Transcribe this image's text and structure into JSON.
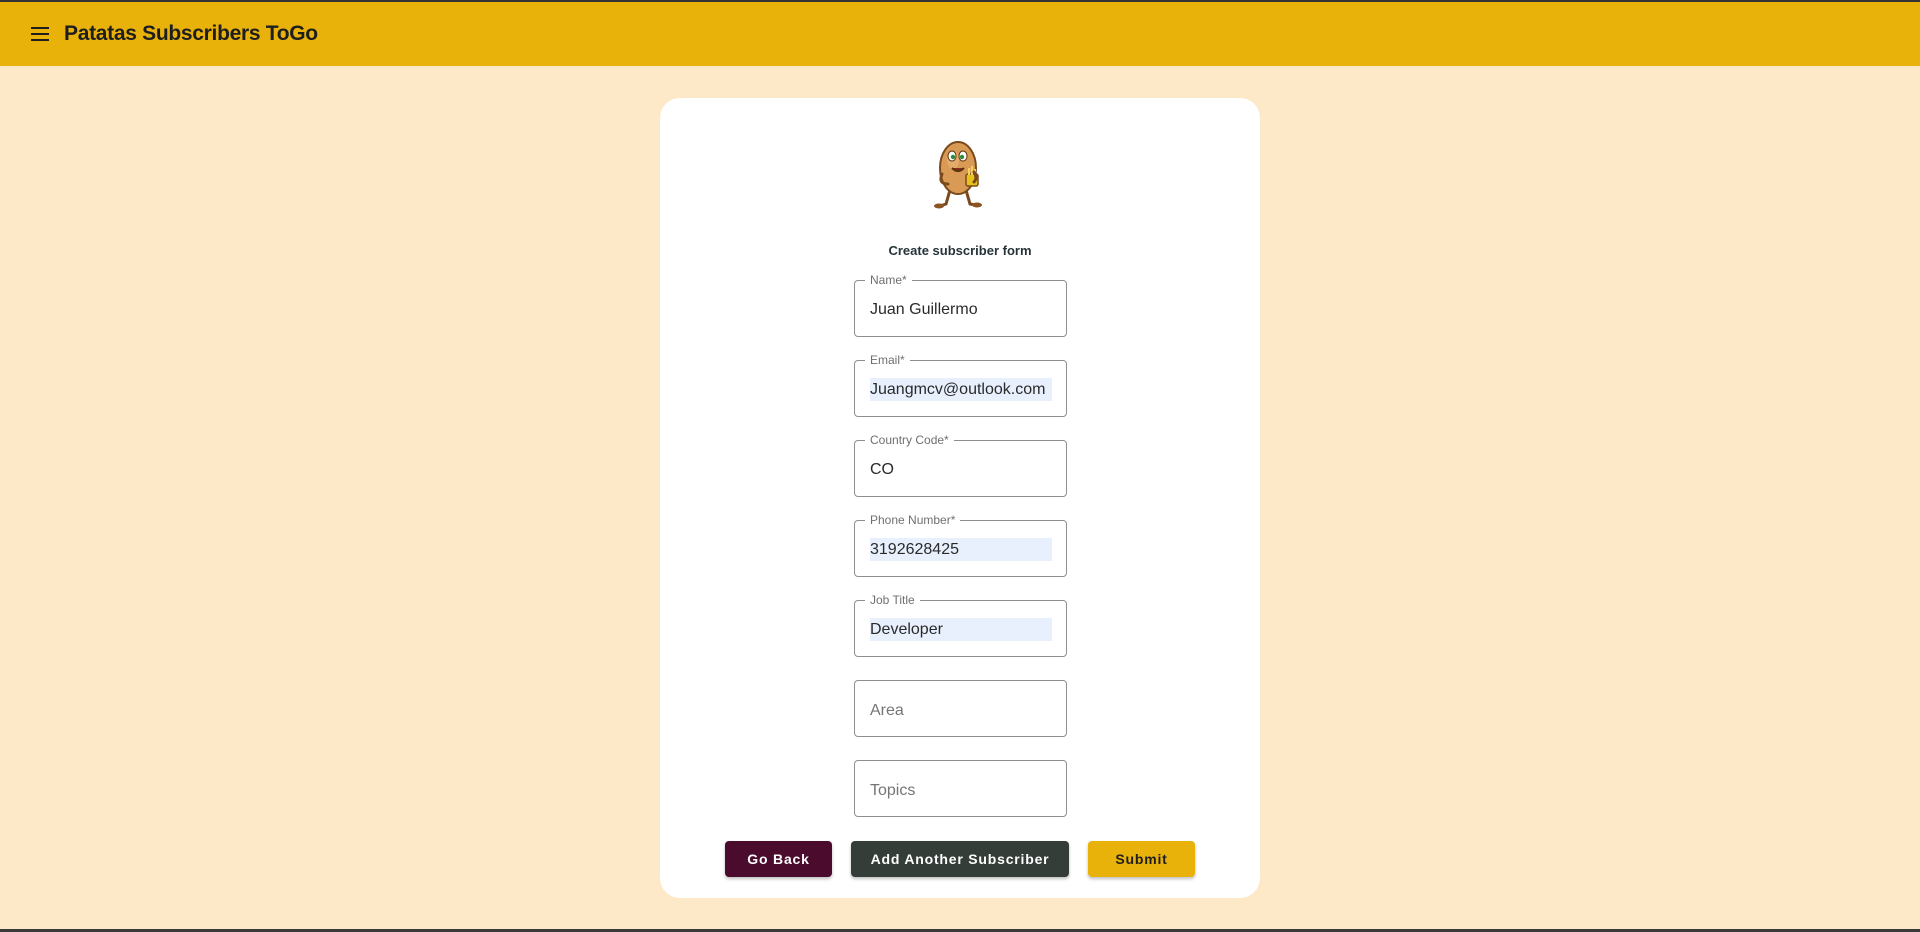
{
  "app": {
    "title": "Patatas Subscribers ToGo",
    "menu_icon": "hamburger-menu-icon",
    "colors": {
      "topbar": "#e8b20b",
      "background": "#fde8c8",
      "go_back": "#4a0b2c",
      "add_another": "#343d38",
      "submit": "#e8b20b"
    }
  },
  "form": {
    "logo": "potato-mascot-logo",
    "title": "Create subscriber form",
    "fields": {
      "name": {
        "label": "Name*",
        "value": "Juan Guillermo"
      },
      "email": {
        "label": "Email*",
        "value": "Juangmcv@outlook.com"
      },
      "country_code": {
        "label": "Country Code*",
        "value": "CO"
      },
      "phone": {
        "label": "Phone Number*",
        "value": "3192628425"
      },
      "job_title": {
        "label": "Job Title",
        "value": "Developer"
      },
      "area": {
        "placeholder": "Area",
        "value": ""
      },
      "topics": {
        "placeholder": "Topics",
        "value": ""
      }
    },
    "buttons": {
      "go_back": "Go Back",
      "add_another": "Add Another Subscriber",
      "submit": "Submit"
    }
  }
}
